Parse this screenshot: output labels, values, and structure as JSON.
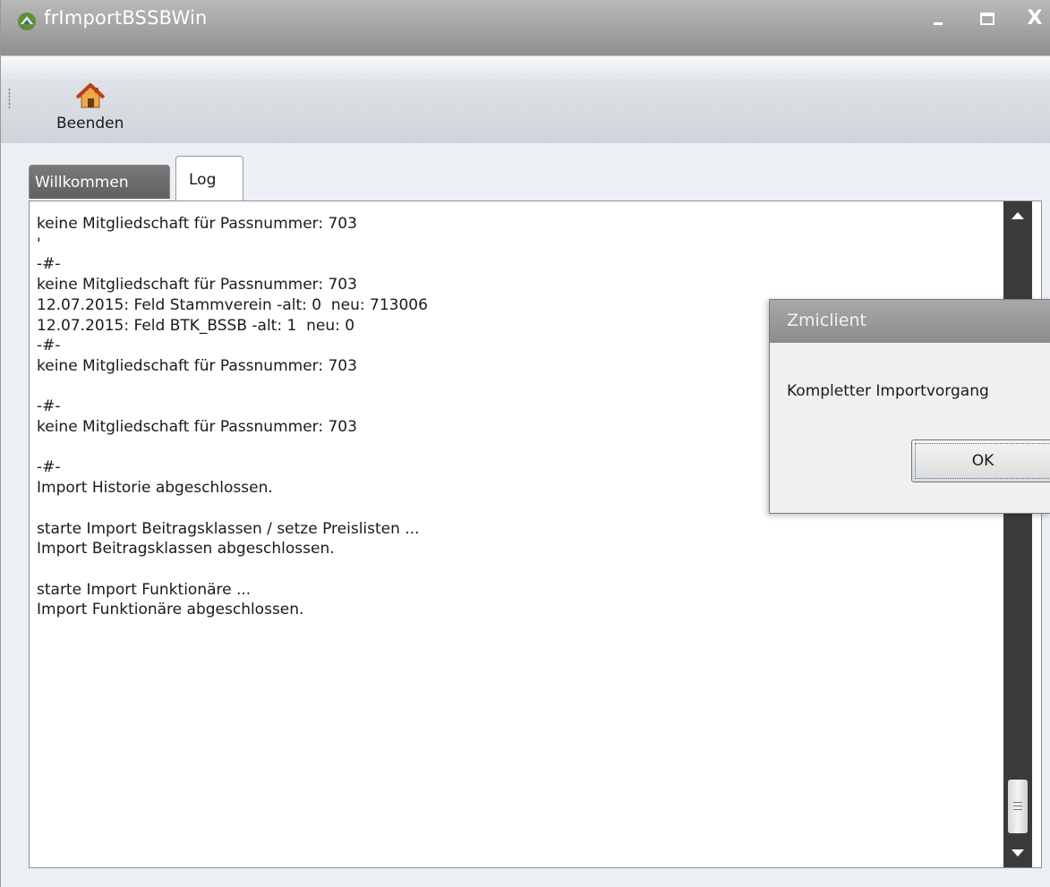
{
  "window": {
    "title": "frImportBSSBWin",
    "minimize_label": "Minimize",
    "maximize_label": "Maximize",
    "close_label": "X"
  },
  "toolbar": {
    "beenden_label": "Beenden",
    "beenden_icon": "house-icon"
  },
  "tabs": [
    {
      "label": "Willkommen",
      "active": false
    },
    {
      "label": "Log",
      "active": true
    }
  ],
  "log": {
    "lines": [
      "keine Mitgliedschaft für Passnummer: 703",
      "'",
      "-#-",
      "keine Mitgliedschaft für Passnummer: 703",
      "12.07.2015: Feld Stammverein -alt: 0  neu: 713006",
      "12.07.2015: Feld BTK_BSSB -alt: 1  neu: 0",
      "-#-",
      "keine Mitgliedschaft für Passnummer: 703",
      "",
      "-#-",
      "keine Mitgliedschaft für Passnummer: 703",
      "",
      "-#-",
      "Import Historie abgeschlossen.",
      "",
      "starte Import Beitragsklassen / setze Preislisten ...",
      "Import Beitragsklassen abgeschlossen.",
      "",
      "starte Import Funktionäre ...",
      "Import Funktionäre abgeschlossen."
    ]
  },
  "dialog": {
    "title": "Zmiclient",
    "message": "Kompletter Importvorgang",
    "ok_label": "OK"
  },
  "colors": {
    "titlebar": "#9f9f9f",
    "scrollbar": "#3b3b3b",
    "active_tab_bg": "#ffffff",
    "inactive_tab_bg": "#6b6b6b"
  }
}
